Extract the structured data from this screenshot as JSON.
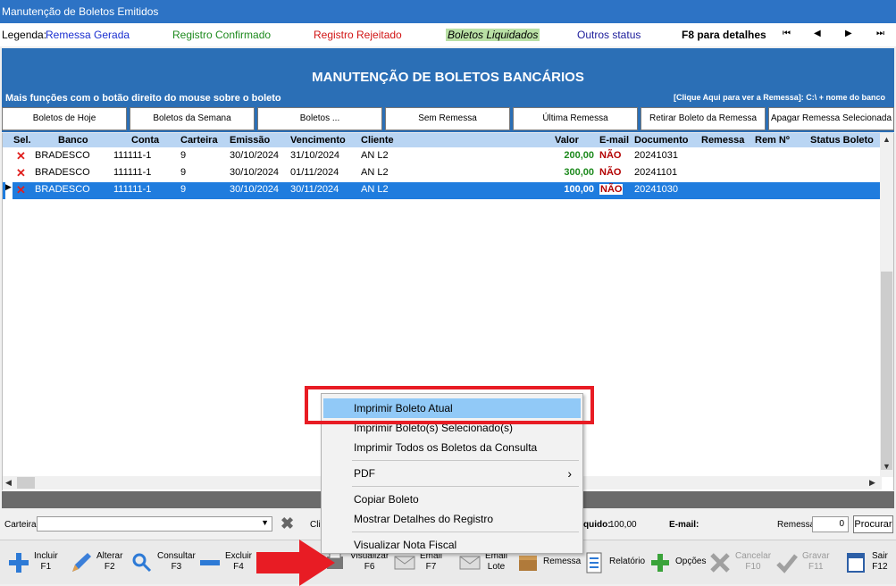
{
  "window": {
    "title": "Manutenção de Boletos Emitidos"
  },
  "legend": {
    "label": "Legenda:",
    "items": [
      {
        "text": "Remessa Gerada",
        "color": "#1a2fd0"
      },
      {
        "text": "Registro Confirmado",
        "color": "#1e8a1e"
      },
      {
        "text": "Registro Rejeitado",
        "color": "#d11414"
      },
      {
        "text": "Boletos Liquidados",
        "color": "#000000"
      },
      {
        "text": "Outros status",
        "color": "#1a1a9a"
      }
    ],
    "details_hint": "F8 para detalhes",
    "nav": {
      "first": "⏮",
      "prev": "◀",
      "next": "▶",
      "last": "⏭"
    }
  },
  "header": {
    "title": "MANUTENÇÃO DE BOLETOS BANCÁRIOS",
    "subtitle": "Mais funções com o botão direito do mouse sobre o boleto",
    "hint": "[Clique Aqui para ver a Remessa]: C:\\ + nome do banco"
  },
  "filter_buttons": [
    "Boletos de Hoje",
    "Boletos da Semana",
    "Boletos ...",
    "Sem Remessa",
    "Última Remessa",
    "Retirar Boleto da Remessa",
    "Apagar Remessa Selecionada"
  ],
  "grid": {
    "columns": [
      "Sel.",
      "Banco",
      "Conta",
      "Carteira",
      "Emissão",
      "Vencimento",
      "Cliente",
      "Valor",
      "E-mail",
      "Documento",
      "Remessa",
      "Rem Nº",
      "Status Boleto"
    ],
    "rows": [
      {
        "sel": "✕",
        "banco": "BRADESCO",
        "conta": "111111-1",
        "carteira": "9",
        "emissao": "30/10/2024",
        "vencimento": "31/10/2024",
        "cliente": "AN L2",
        "valor": "200,00",
        "email": "NÃO",
        "documento": "20241031",
        "selected": false
      },
      {
        "sel": "✕",
        "banco": "BRADESCO",
        "conta": "111111-1",
        "carteira": "9",
        "emissao": "30/10/2024",
        "vencimento": "01/11/2024",
        "cliente": "AN L2",
        "valor": "300,00",
        "email": "NÃO",
        "documento": "20241101",
        "selected": false
      },
      {
        "sel": "✕",
        "banco": "BRADESCO",
        "conta": "111111-1",
        "carteira": "9",
        "emissao": "30/10/2024",
        "vencimento": "30/11/2024",
        "cliente": "AN L2",
        "valor": "100,00",
        "email": "NÃO",
        "documento": "20241030",
        "selected": true
      }
    ]
  },
  "filter_bar": {
    "carteira_label": "Carteira",
    "cliente_label": "Cli",
    "liquido_label": "quido:",
    "liquido_value": "100,00",
    "email_label": "E-mail:",
    "remessa_label": "Remessa",
    "remessa_value": "0",
    "search_label": "Procurar"
  },
  "toolbar": [
    {
      "label": "Incluir\nF1",
      "icon": "plus-icon",
      "disabled": false
    },
    {
      "label": "Alterar\nF2",
      "icon": "pencil-icon",
      "disabled": false
    },
    {
      "label": "Consultar\nF3",
      "icon": "magnifier-icon",
      "disabled": false
    },
    {
      "label": "Excluir\nF4",
      "icon": "minus-icon",
      "disabled": false
    },
    {
      "label": "Visualizar\nF6",
      "icon": "print-icon",
      "disabled": false
    },
    {
      "label": "Email\nF7",
      "icon": "email-icon",
      "disabled": false
    },
    {
      "label": "Email\nLote",
      "icon": "email-batch-icon",
      "disabled": false
    },
    {
      "label": "Remessa",
      "icon": "box-icon",
      "disabled": false
    },
    {
      "label": "Relatório",
      "icon": "report-icon",
      "disabled": false
    },
    {
      "label": "Opções",
      "icon": "green-plus-icon",
      "disabled": false
    },
    {
      "label": "Cancelar\nF10",
      "icon": "cancel-icon",
      "disabled": true
    },
    {
      "label": "Gravar\nF11",
      "icon": "check-icon",
      "disabled": true
    },
    {
      "label": "Sair\nF12",
      "icon": "exit-icon",
      "disabled": false
    }
  ],
  "context_menu": {
    "items": [
      {
        "label": "Imprimir Boleto Atual",
        "highlighted": true
      },
      {
        "label": "Imprimir Boleto(s) Selecionado(s)"
      },
      {
        "label": "Imprimir Todos os Boletos da Consulta"
      },
      {
        "label": "PDF",
        "submenu": "›"
      },
      {
        "label": "Copiar Boleto"
      },
      {
        "label": "Mostrar Detalhes do Registro"
      },
      {
        "label": "Visualizar Nota Fiscal"
      }
    ]
  },
  "colors": {
    "accent": "#2b6fb6",
    "highlight_box": "#e81c24",
    "selected_row": "#1f7cde"
  }
}
